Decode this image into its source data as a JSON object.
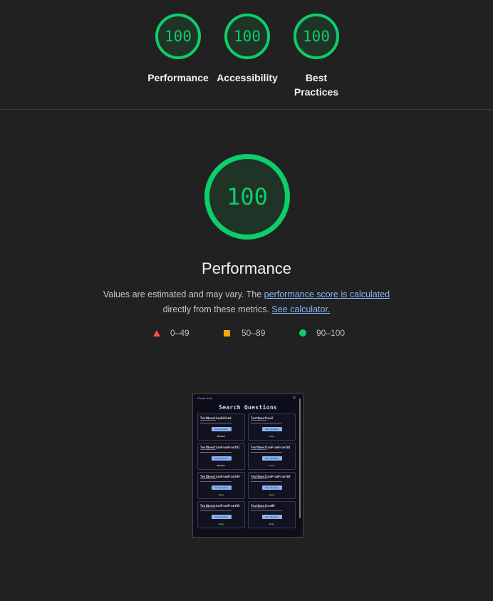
{
  "top_gauges": [
    {
      "score": "100",
      "label": "Performance"
    },
    {
      "score": "100",
      "label": "Accessibility"
    },
    {
      "score": "100",
      "label": "Best Practices"
    }
  ],
  "main": {
    "score": "100",
    "title": "Performance",
    "desc_part1": "Values are estimated and may vary. The ",
    "desc_link1": "performance score is calculated",
    "desc_part2": " directly from these metrics. ",
    "desc_link2": "See calculator."
  },
  "legend": [
    {
      "range": "0–49",
      "color": "#ff4e42"
    },
    {
      "range": "50–89",
      "color": "#ffa400"
    },
    {
      "range": "90–100",
      "color": "#0cce6b"
    }
  ],
  "screenshot": {
    "brand": "Planet Hoth",
    "close": "⊠",
    "title": "Search Questions",
    "button_label": "View Question",
    "cards": [
      {
        "title": "TestQuestionEdited",
        "difficulty": "Medium",
        "color": "#ffd166"
      },
      {
        "title": "TestQuestion2",
        "difficulty": "Easy",
        "color": "#7fd88f"
      },
      {
        "title": "TestQuestionFromFront01",
        "difficulty": "Medium",
        "color": "#ffd166"
      },
      {
        "title": "TestQuestionFromFront02",
        "difficulty": "Expert",
        "color": "#ff6b6b"
      },
      {
        "title": "TestQuestionFromFront04",
        "difficulty": "Easy",
        "color": "#7fd88f"
      },
      {
        "title": "TestQuestionFromFront03",
        "difficulty": "Hard",
        "color": "#ffa94d"
      },
      {
        "title": "TestQuestionFromFront05",
        "difficulty": "Easy",
        "color": "#7fd88f"
      },
      {
        "title": "TestQuestion09",
        "difficulty": "Easy",
        "color": "#7fd88f"
      }
    ]
  }
}
